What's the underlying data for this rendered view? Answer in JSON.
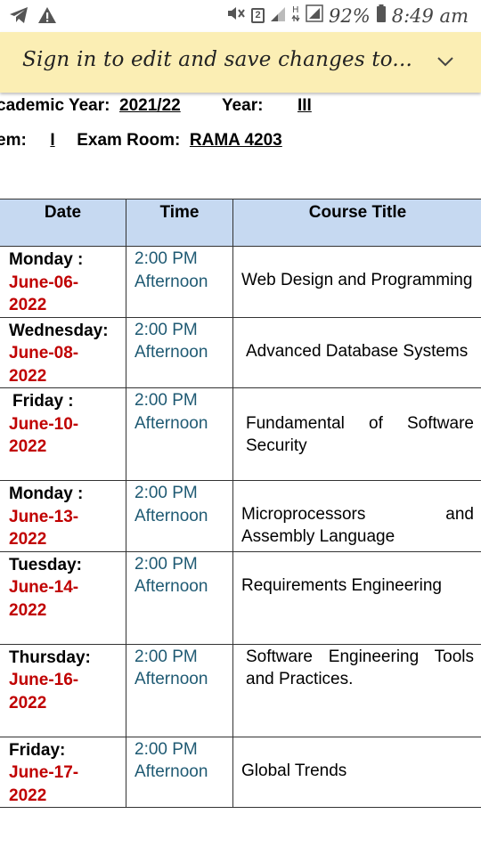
{
  "status_bar": {
    "icons_left": [
      "telegram-icon",
      "warning-icon"
    ],
    "icons_right": [
      "mute-icon",
      "sim-2-icon",
      "signal-icon",
      "h-plus-icon",
      "signal-bars-icon",
      "battery-icon"
    ],
    "sim_number": "2",
    "battery": "92%",
    "time": "8:49 am"
  },
  "banner": {
    "text": "Sign in to edit and save changes to...",
    "background": "#fbeeb4"
  },
  "header": {
    "academic_year_label": "cademic Year:",
    "academic_year_value": "2021/22",
    "year_label": "Year:",
    "year_value": "III",
    "semester_label": "em:",
    "semester_value": "I",
    "exam_room_label": "Exam Room:",
    "exam_room_value": "RAMA 4203"
  },
  "table": {
    "columns": [
      "Date",
      "Time",
      "Course Title"
    ],
    "header_color": "#c6d9f1",
    "date_color": "#c00000",
    "time_color": "#1f5a73",
    "rows": [
      {
        "day": "Monday :",
        "date": "June-06-2022",
        "time": "2:00 PM",
        "period": "Afternoon",
        "course": "Web Design and Programming"
      },
      {
        "day": "Wednesday:",
        "date": "June-08-2022",
        "time": "2:00 PM",
        "period": "Afternoon",
        "course": "Advanced Database Systems"
      },
      {
        "day": "Friday :",
        "date": "June-10-2022",
        "time": "2:00 PM",
        "period": "Afternoon",
        "course": "Fundamental of Software Security"
      },
      {
        "day": "Monday :",
        "date": "June-13-2022",
        "time": "2:00 PM",
        "period": "Afternoon",
        "course": "Microprocessors and Assembly Language"
      },
      {
        "day": "Tuesday:",
        "date": "June-14-2022",
        "time": "2:00 PM",
        "period": "Afternoon",
        "course": "Requirements Engineering"
      },
      {
        "day": "Thursday:",
        "date": "June-16-2022",
        "time": "2:00 PM",
        "period": "Afternoon",
        "course": "Software Engineering Tools and Practices."
      },
      {
        "day": "Friday:",
        "date": "June-17-2022",
        "time": "2:00 PM",
        "period": "Afternoon",
        "course": "Global Trends"
      }
    ]
  }
}
